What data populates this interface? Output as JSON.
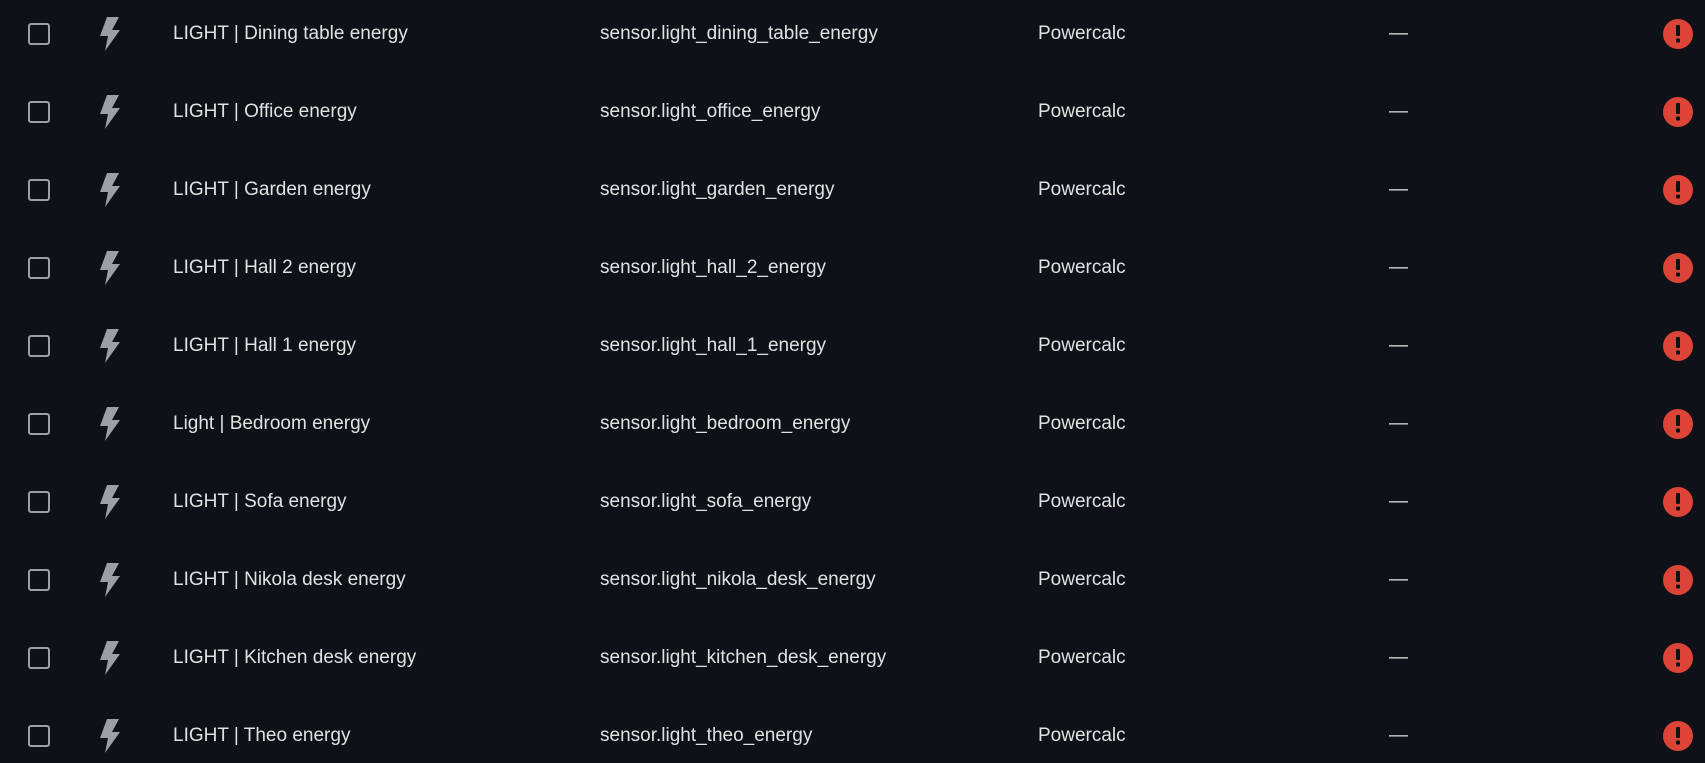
{
  "colors": {
    "background": "#0e1117",
    "text": "#e1e1e1",
    "icon": "#9aa0a6",
    "error": "#db4437"
  },
  "rows": [
    {
      "name": "LIGHT | Dining table energy",
      "entity_id": "sensor.light_dining_table_energy",
      "integration": "Powercalc",
      "area": "—",
      "icon": "flash-icon",
      "status_icon": "alert-circle-icon"
    },
    {
      "name": "LIGHT | Office energy",
      "entity_id": "sensor.light_office_energy",
      "integration": "Powercalc",
      "area": "—",
      "icon": "flash-icon",
      "status_icon": "alert-circle-icon"
    },
    {
      "name": "LIGHT | Garden energy",
      "entity_id": "sensor.light_garden_energy",
      "integration": "Powercalc",
      "area": "—",
      "icon": "flash-icon",
      "status_icon": "alert-circle-icon"
    },
    {
      "name": "LIGHT | Hall 2 energy",
      "entity_id": "sensor.light_hall_2_energy",
      "integration": "Powercalc",
      "area": "—",
      "icon": "flash-icon",
      "status_icon": "alert-circle-icon"
    },
    {
      "name": "LIGHT | Hall 1 energy",
      "entity_id": "sensor.light_hall_1_energy",
      "integration": "Powercalc",
      "area": "—",
      "icon": "flash-icon",
      "status_icon": "alert-circle-icon"
    },
    {
      "name": "Light | Bedroom energy",
      "entity_id": "sensor.light_bedroom_energy",
      "integration": "Powercalc",
      "area": "—",
      "icon": "flash-icon",
      "status_icon": "alert-circle-icon"
    },
    {
      "name": "LIGHT | Sofa energy",
      "entity_id": "sensor.light_sofa_energy",
      "integration": "Powercalc",
      "area": "—",
      "icon": "flash-icon",
      "status_icon": "alert-circle-icon"
    },
    {
      "name": "LIGHT | Nikola desk energy",
      "entity_id": "sensor.light_nikola_desk_energy",
      "integration": "Powercalc",
      "area": "—",
      "icon": "flash-icon",
      "status_icon": "alert-circle-icon"
    },
    {
      "name": "LIGHT | Kitchen desk energy",
      "entity_id": "sensor.light_kitchen_desk_energy",
      "integration": "Powercalc",
      "area": "—",
      "icon": "flash-icon",
      "status_icon": "alert-circle-icon"
    },
    {
      "name": "LIGHT | Theo energy",
      "entity_id": "sensor.light_theo_energy",
      "integration": "Powercalc",
      "area": "—",
      "icon": "flash-icon",
      "status_icon": "alert-circle-icon"
    }
  ]
}
